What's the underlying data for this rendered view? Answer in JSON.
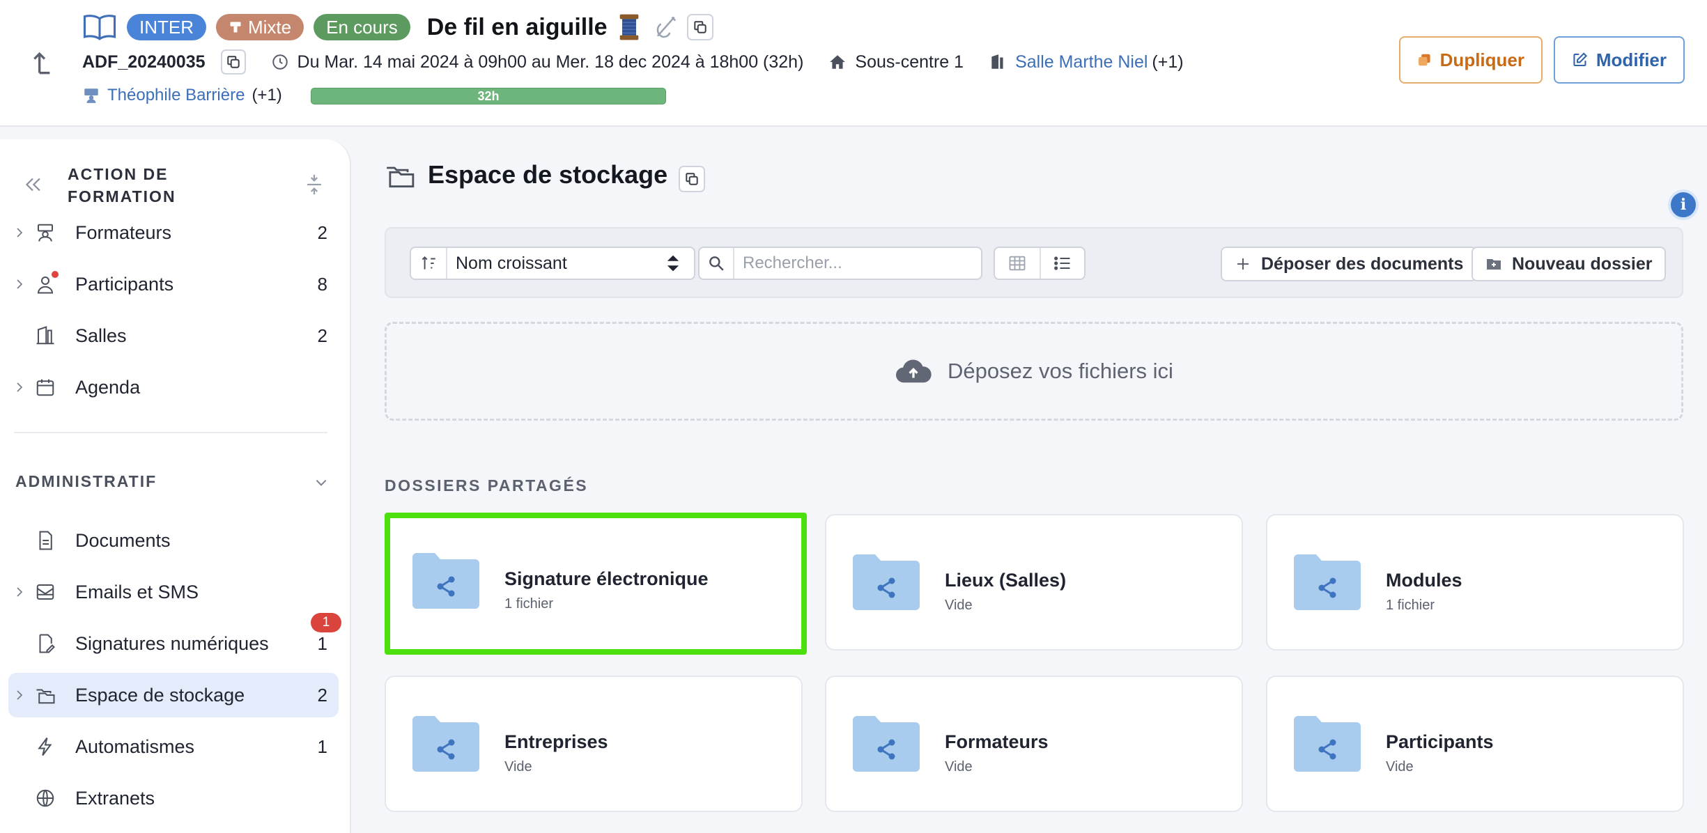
{
  "header": {
    "badges": {
      "inter": "INTER",
      "mixte": "Mixte",
      "en_cours": "En cours"
    },
    "title": "De fil en aiguille",
    "reference": "ADF_20240035",
    "dates": "Du Mar. 14 mai 2024 à 09h00 au Mer. 18 dec 2024 à 18h00 (32h)",
    "site": "Sous-centre 1",
    "room": "Salle Marthe Niel",
    "room_extra": "(+1)",
    "trainer": "Théophile Barrière",
    "trainer_extra": "(+1)",
    "progress_label": "32h",
    "progress_percent": 100,
    "dupliquer": "Dupliquer",
    "modifier": "Modifier"
  },
  "sidebar": {
    "section_title": "ACTION DE FORMATION",
    "items": [
      {
        "label": "Formateurs",
        "count": "2"
      },
      {
        "label": "Participants",
        "count": "8"
      },
      {
        "label": "Salles",
        "count": "2"
      },
      {
        "label": "Agenda",
        "count": ""
      }
    ],
    "admin_title": "ADMINISTRATIF",
    "admin_items": [
      {
        "label": "Documents",
        "count": ""
      },
      {
        "label": "Emails et SMS",
        "count": ""
      },
      {
        "label": "Signatures numériques",
        "count": "1",
        "badge": "1"
      },
      {
        "label": "Espace de stockage",
        "count": "2"
      },
      {
        "label": "Automatismes",
        "count": "1"
      },
      {
        "label": "Extranets",
        "count": ""
      }
    ]
  },
  "main": {
    "title": "Espace de stockage",
    "sort_label": "Nom croissant",
    "search_placeholder": "Rechercher...",
    "btn_deposer": "Déposer des documents",
    "btn_nouveau": "Nouveau dossier",
    "dropzone": "Déposez vos fichiers ici",
    "shared_title": "DOSSIERS PARTAGÉS",
    "folders": [
      {
        "name": "Signature électronique",
        "sub": "1 fichier"
      },
      {
        "name": "Lieux (Salles)",
        "sub": "Vide"
      },
      {
        "name": "Modules",
        "sub": "1 fichier"
      },
      {
        "name": "Entreprises",
        "sub": "Vide"
      },
      {
        "name": "Formateurs",
        "sub": "Vide"
      },
      {
        "name": "Participants",
        "sub": "Vide"
      }
    ]
  },
  "colors": {
    "accent": "#3c77c8",
    "selection": "#4ce00e",
    "folder": "#a8cbee",
    "progress": "#6db57a"
  },
  "icons": [
    "back-icon",
    "book-icon",
    "spool-icon",
    "needle-icon",
    "copy-icon",
    "clock-icon",
    "home-icon",
    "room-icon",
    "trainer-icon",
    "folder-share-icon",
    "cloud-upload-icon",
    "search-icon",
    "sort-icon",
    "grid-icon",
    "list-icon",
    "plus-icon",
    "folder-plus-icon",
    "info-icon"
  ]
}
